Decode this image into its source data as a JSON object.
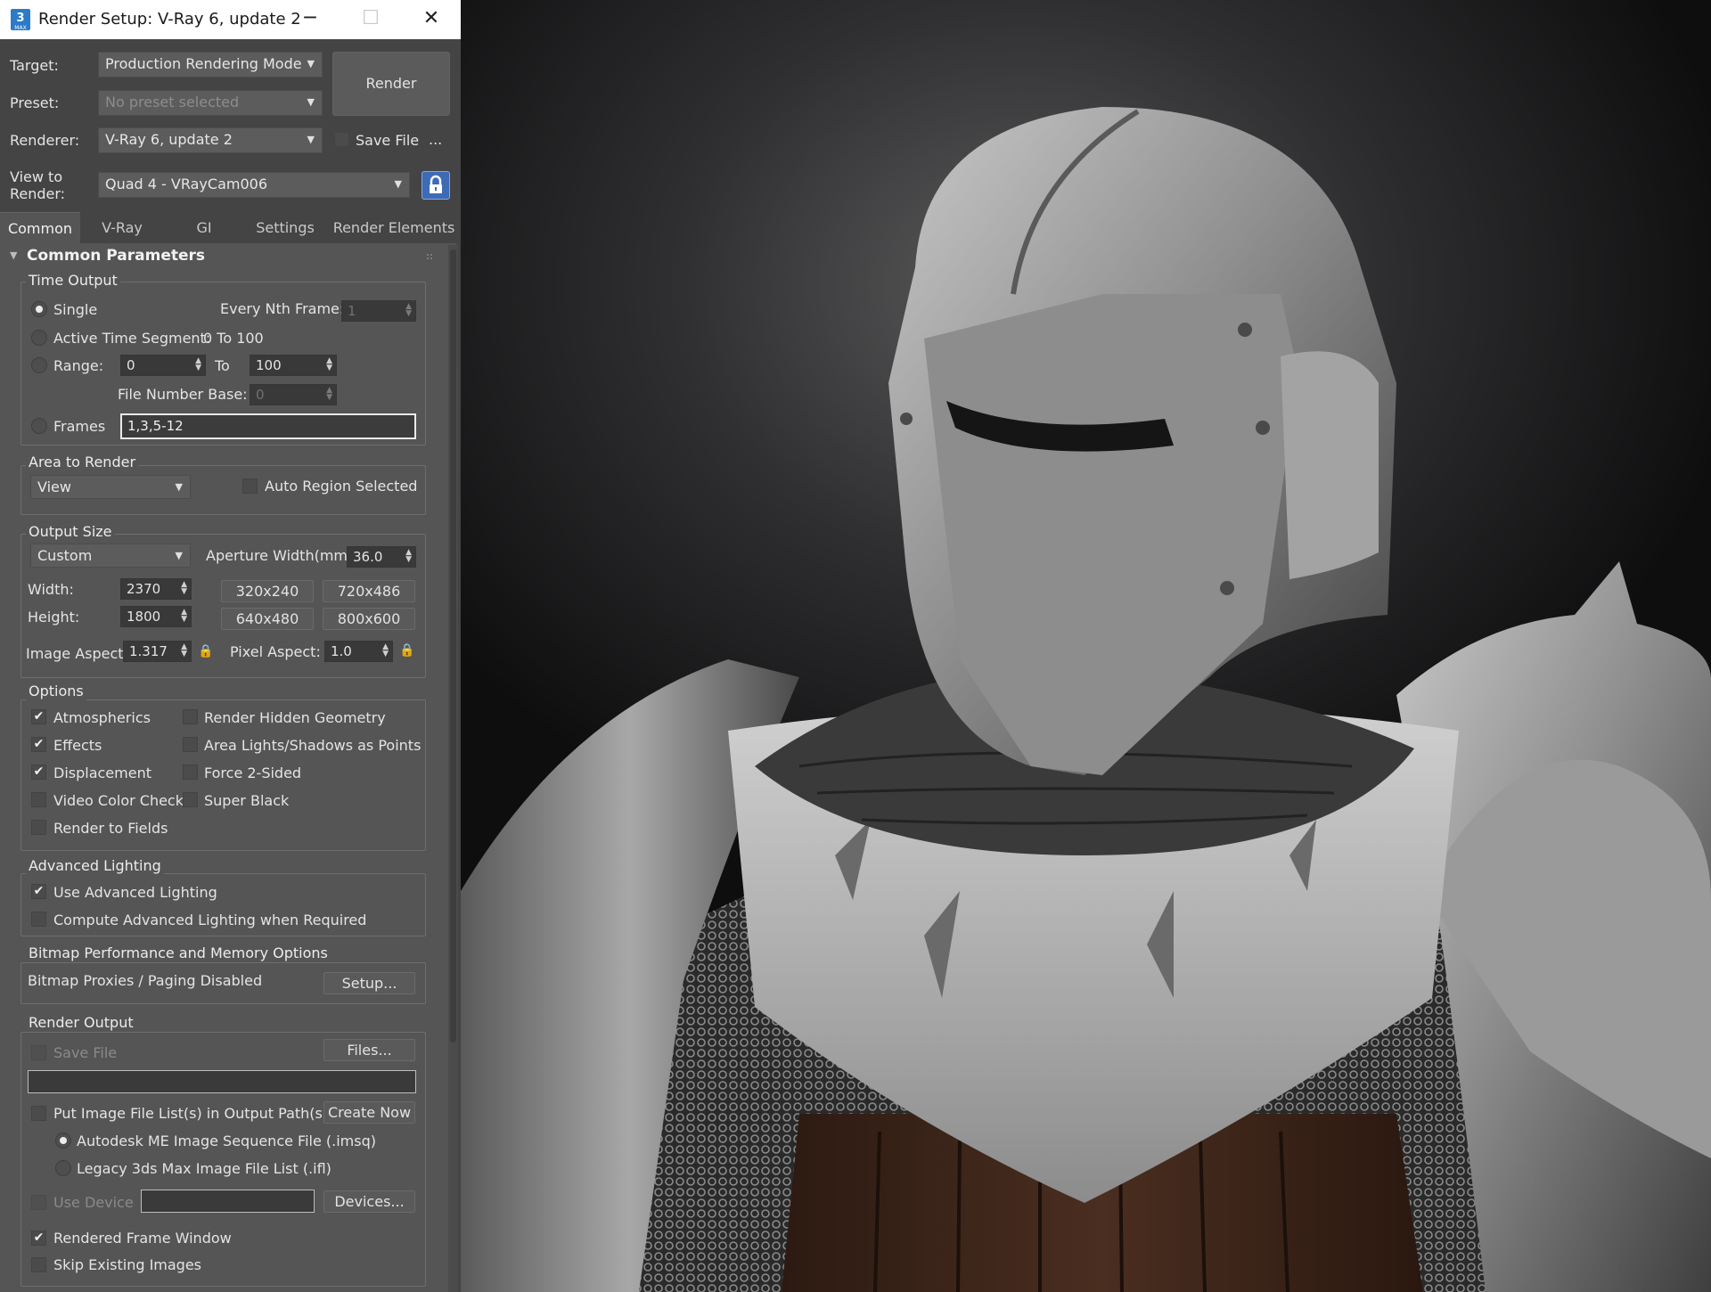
{
  "window": {
    "title": "Render Setup: V-Ray 6, update 2",
    "app_icon": "3ds-max-icon",
    "minimize": "─",
    "maximize": "☐",
    "close": "✕"
  },
  "header": {
    "target_label": "Target:",
    "target_value": "Production Rendering Mode",
    "preset_label": "Preset:",
    "preset_value": "No preset selected",
    "renderer_label": "Renderer:",
    "renderer_value": "V-Ray 6, update 2",
    "save_file_label": "Save File",
    "save_file_checked": false,
    "more_label": "...",
    "view_label": "View to\nRender:",
    "view_value": "Quad 4 - VRayCam006",
    "render_button": "Render"
  },
  "tabs": [
    "Common",
    "V-Ray",
    "GI",
    "Settings",
    "Render Elements"
  ],
  "active_tab": "Common",
  "rollout": {
    "title": "Common Parameters",
    "collapse_icon": "▼"
  },
  "time_output": {
    "title": "Time Output",
    "single": "Single",
    "every_nth_frame_label": "Every Nth Frame:",
    "every_nth_frame_value": "1",
    "active_time_segment": "Active Time Segment:",
    "active_time_segment_value": "0 To 100",
    "range": "Range:",
    "range_from": "0",
    "range_to_label": "To",
    "range_to": "100",
    "file_number_base_label": "File Number Base:",
    "file_number_base_value": "0",
    "frames": "Frames",
    "frames_value": "1,3,5-12",
    "selected": "single"
  },
  "area_to_render": {
    "title": "Area to Render",
    "value": "View",
    "auto_region_label": "Auto Region Selected",
    "auto_region_checked": false
  },
  "output_size": {
    "title": "Output Size",
    "preset": "Custom",
    "aperture_label": "Aperture Width(mm):",
    "aperture_value": "36.0",
    "width_label": "Width:",
    "width_value": "2370",
    "height_label": "Height:",
    "height_value": "1800",
    "presets": [
      "320x240",
      "720x486",
      "640x480",
      "800x600"
    ],
    "image_aspect_label": "Image Aspect:",
    "image_aspect_value": "1.317",
    "pixel_aspect_label": "Pixel Aspect:",
    "pixel_aspect_value": "1.0"
  },
  "options": {
    "title": "Options",
    "atmospherics": "Atmospherics",
    "effects": "Effects",
    "displacement": "Displacement",
    "video_color_check": "Video Color Check",
    "render_to_fields": "Render to Fields",
    "render_hidden_geometry": "Render Hidden Geometry",
    "area_lights": "Area Lights/Shadows as Points",
    "force_2_sided": "Force 2-Sided",
    "super_black": "Super Black",
    "checked": [
      "atmospherics",
      "effects",
      "displacement"
    ]
  },
  "advanced_lighting": {
    "title": "Advanced Lighting",
    "use_advanced_lighting": "Use Advanced Lighting",
    "compute_advanced_lighting": "Compute Advanced Lighting when Required",
    "use_checked": true,
    "compute_checked": false
  },
  "bitmap": {
    "title": "Bitmap Performance and Memory Options",
    "status": "Bitmap Proxies / Paging Disabled",
    "setup_button": "Setup..."
  },
  "render_output": {
    "title": "Render Output",
    "save_file": "Save File",
    "files_button": "Files...",
    "output_path": "",
    "put_image_file_list": "Put Image File List(s) in Output Path(s)",
    "create_now_button": "Create Now",
    "autodesk_me": "Autodesk ME Image Sequence File (.imsq)",
    "legacy_3ds": "Legacy 3ds Max Image File List (.ifl)",
    "use_device": "Use Device",
    "device_value": "",
    "devices_button": "Devices...",
    "rendered_frame_window": "Rendered Frame Window",
    "skip_existing_images": "Skip Existing Images",
    "rendered_frame_window_checked": true,
    "skip_existing_checked": false
  },
  "icons": {
    "check": "✔",
    "arrow": "▼",
    "spinner": "▲▼",
    "lock": "🔒"
  },
  "viewport": {
    "subject": "knight-render",
    "colors": {
      "background": "#0b0b0c",
      "panel": "#555555",
      "accent": "#3d6bb5"
    }
  }
}
